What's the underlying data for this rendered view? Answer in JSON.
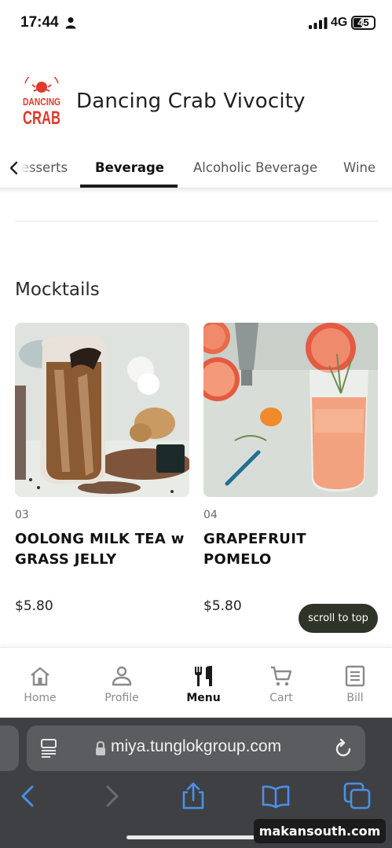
{
  "status_bar": {
    "time": "17:44",
    "network": "4G",
    "battery": "45",
    "battery_level": 0.45
  },
  "header": {
    "logo_text": [
      "DANCING",
      "CRAB"
    ],
    "title": "Dancing Crab Vivocity"
  },
  "tabs": {
    "items": [
      "Desserts",
      "Beverage",
      "Alcoholic Beverage",
      "Wine"
    ],
    "active": "Beverage"
  },
  "section": {
    "title": "Mocktails"
  },
  "products": [
    {
      "number": "03",
      "name": "OOLONG MILK TEA w GRASS JELLY",
      "price": "$5.80"
    },
    {
      "number": "04",
      "name": "GRAPEFRUIT POMELO",
      "price": "$5.80"
    }
  ],
  "scroll_to_top": "scroll to top",
  "bottom_nav": {
    "items": [
      {
        "label": "Home",
        "icon": "home-icon"
      },
      {
        "label": "Profile",
        "icon": "profile-icon"
      },
      {
        "label": "Menu",
        "icon": "menu-utensils-icon"
      },
      {
        "label": "Cart",
        "icon": "cart-icon"
      },
      {
        "label": "Bill",
        "icon": "bill-icon"
      }
    ],
    "active": "Menu"
  },
  "browser": {
    "url": "miya.tunglokgroup.com"
  },
  "watermark": "makansouth.com",
  "colors": {
    "brand_red": "#e03a2c",
    "scroll_button": "#2f3429",
    "safari_blue": "#4a90e6"
  }
}
